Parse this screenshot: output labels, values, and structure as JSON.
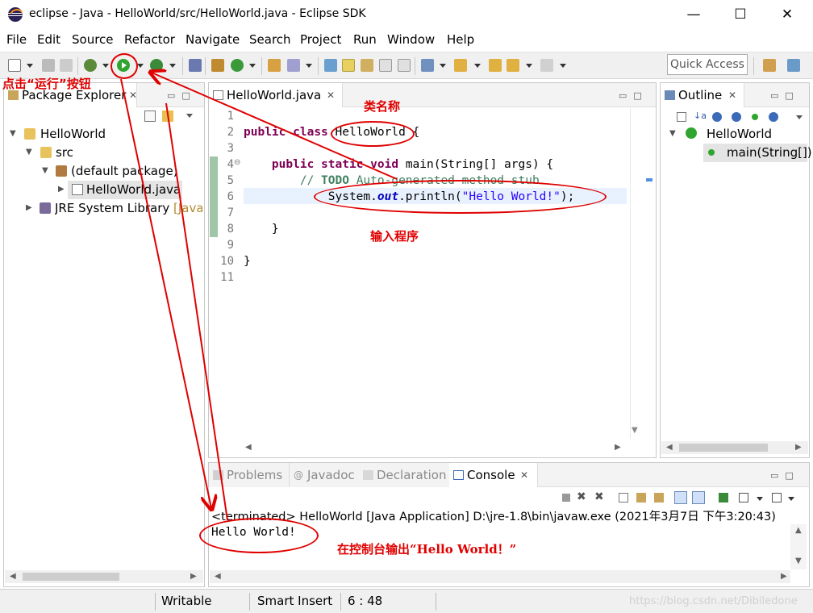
{
  "window": {
    "title": "eclipse - Java - HelloWorld/src/HelloWorld.java - Eclipse SDK",
    "minimize": "—",
    "maximize": "☐",
    "close": "✕"
  },
  "menu": [
    "File",
    "Edit",
    "Source",
    "Refactor",
    "Navigate",
    "Search",
    "Project",
    "Run",
    "Window",
    "Help"
  ],
  "toolbar": {
    "quick_access": "Quick Access"
  },
  "package_explorer": {
    "title": "Package Explorer",
    "items": [
      {
        "label": "HelloWorld"
      },
      {
        "label": "src"
      },
      {
        "label": "(default package)"
      },
      {
        "label": "HelloWorld.java"
      },
      {
        "label": "JRE System Library",
        "suffix": "[JavaS"
      }
    ]
  },
  "editor": {
    "tab": "HelloWorld.java",
    "line_numbers": [
      "1",
      "2",
      "3",
      "4",
      "5",
      "6",
      "7",
      "8",
      "9",
      "10",
      "11"
    ]
  },
  "outline": {
    "title": "Outline",
    "items": [
      {
        "label": "HelloWorld"
      },
      {
        "label": "main(String[])"
      }
    ]
  },
  "console": {
    "tabs": [
      "Problems",
      "Javadoc",
      "Declaration",
      "Console"
    ],
    "terminated_line": "<terminated> HelloWorld [Java Application] D:\\jre-1.8\\bin\\javaw.exe (2021年3月7日 下午3:20:43)",
    "output": "Hello World!"
  },
  "statusbar": {
    "writable": "Writable",
    "insert_mode": "Smart Insert",
    "position": "6 : 48",
    "watermark": "https://blog.csdn.net/Dibiledone"
  },
  "annotations": {
    "run_button": "点击“运行”按钮",
    "class_name": "类名称",
    "input_program": "输入程序",
    "console_output": "在控制台输出“Hello World！”"
  },
  "colors": {
    "annotation_red": "#e00000",
    "keyword": "#7f0055",
    "string": "#2a00ff",
    "comment": "#3f7f5f",
    "field": "#0000c0"
  }
}
